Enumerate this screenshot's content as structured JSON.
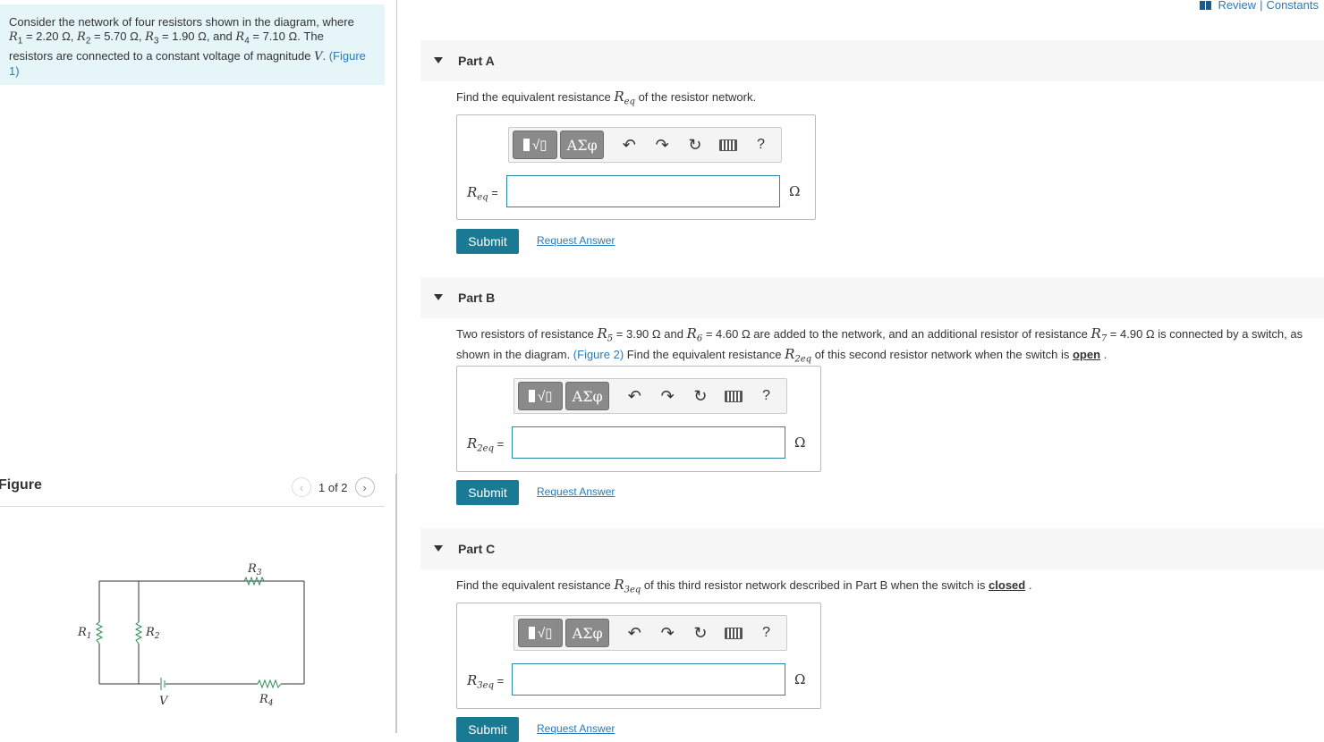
{
  "header": {
    "review": "Review",
    "separator": "|",
    "constants": "Constants"
  },
  "problem": {
    "line1": "Consider the network of four resistors shown in the diagram, where",
    "r1": "R",
    "r1sub": "1",
    "r1val": " = 2.20  Ω, ",
    "r2": "R",
    "r2sub": "2",
    "r2val": " = 5.70  Ω, ",
    "r3": "R",
    "r3sub": "3",
    "r3val": " = 1.90  Ω, and ",
    "r4": "R",
    "r4sub": "4",
    "r4val": " = 7.10  Ω. The",
    "line3a": "resistors are connected to a constant voltage of magnitude ",
    "v": "V",
    "line3b": ". ",
    "figlink": "(Figure 1)"
  },
  "figure": {
    "title": "Figure",
    "pager": "1 of 2",
    "prev": "‹",
    "next": "›",
    "labels": {
      "r1": "R",
      "r1s": "1",
      "r2": "R",
      "r2s": "2",
      "r3": "R",
      "r3s": "3",
      "r4": "R",
      "r4s": "4",
      "v": "V"
    }
  },
  "parts": [
    {
      "label": "Part A",
      "q_a": "Find the equivalent resistance ",
      "q_sym": "R",
      "q_sub": "eq",
      "q_b": " of the resistor network.",
      "ans_sym": "R",
      "ans_sub": "eq",
      "ans_eq": " =",
      "unit": "Ω",
      "submit": "Submit",
      "request": "Request Answer"
    },
    {
      "label": "Part B",
      "q1a": "Two resistors of resistance ",
      "q1r5": "R",
      "q1r5s": "5",
      "q1r5v": " = 3.90  Ω and ",
      "q1r6": "R",
      "q1r6s": "6",
      "q1r6v": " = 4.60  Ω are added to the network, and an additional resistor of resistance ",
      "q1r7": "R",
      "q1r7s": "7",
      "q1r7v": " = 4.90  Ω is connected by a switch, as",
      "q2a": "shown in the diagram. ",
      "q2link": "(Figure 2)",
      "q2b": " Find the equivalent resistance ",
      "q2sym": "R",
      "q2sub": "2eq",
      "q2c": " of this second resistor network when the switch is ",
      "q2state": "open",
      "q2d": " .",
      "ans_sym": "R",
      "ans_sub": "2eq",
      "ans_eq": " =",
      "unit": "Ω",
      "submit": "Submit",
      "request": "Request Answer"
    },
    {
      "label": "Part C",
      "q_a": "Find the equivalent resistance ",
      "q_sym": "R",
      "q_sub": "3eq",
      "q_b": " of this third resistor network described in Part B when the switch is ",
      "q_state": "closed",
      "q_c": " .",
      "ans_sym": "R",
      "ans_sub": "3eq",
      "ans_eq": " =",
      "unit": "Ω",
      "submit": "Submit",
      "request": "Request Answer"
    }
  ],
  "toolbar": {
    "greek": "ΑΣφ",
    "help": "?",
    "undo": "↶",
    "redo": "↷",
    "reset": "↻"
  }
}
